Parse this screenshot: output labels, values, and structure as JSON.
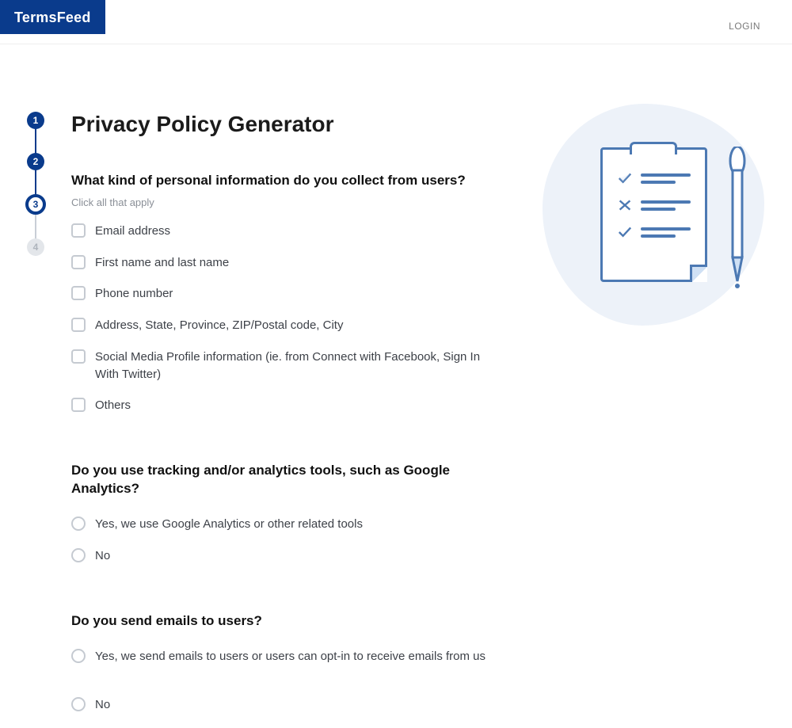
{
  "brand": {
    "name_strong": "Terms",
    "name_light": "Feed"
  },
  "nav": {
    "login": "LOGIN"
  },
  "stepper": {
    "steps": [
      "1",
      "2",
      "3",
      "4"
    ],
    "current_index": 2
  },
  "title": "Privacy Policy Generator",
  "q1": {
    "title": "What kind of personal information do you collect from users?",
    "help": "Click all that apply",
    "options": [
      "Email address",
      "First name and last name",
      "Phone number",
      "Address, State, Province, ZIP/Postal code, City",
      "Social Media Profile information (ie. from Connect with Facebook, Sign In With Twitter)",
      "Others"
    ]
  },
  "q2": {
    "title": "Do you use tracking and/or analytics tools, such as Google Analytics?",
    "options": [
      "Yes, we use Google Analytics or other related tools",
      "No"
    ]
  },
  "q3": {
    "title": "Do you send emails to users?",
    "options": [
      "Yes, we send emails to users or users can opt-in to receive emails from us",
      "No"
    ]
  }
}
